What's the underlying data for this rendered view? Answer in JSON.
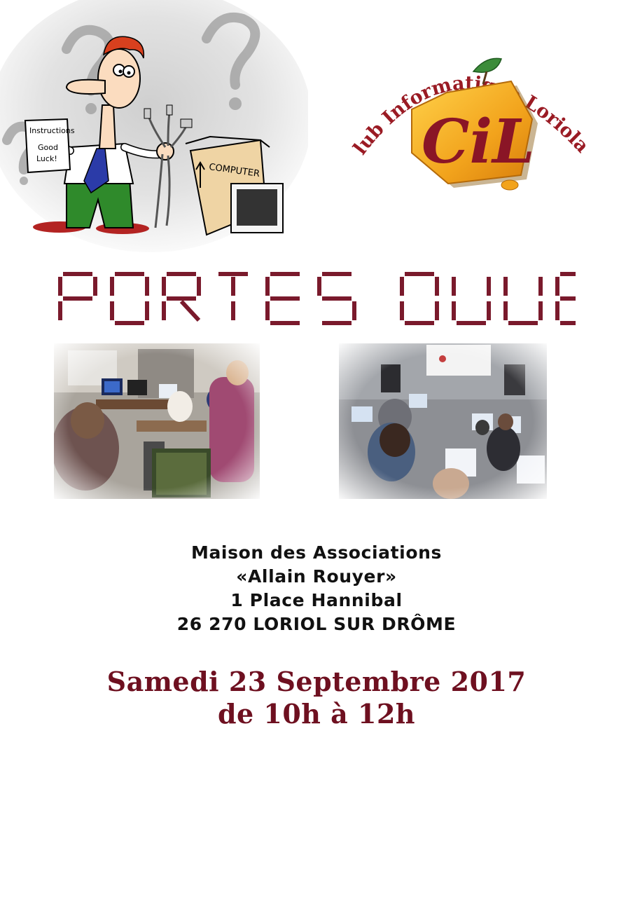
{
  "cartoon": {
    "paper_line1": "Instructions",
    "paper_line2": "Good",
    "paper_line3": "Luck!",
    "box_label": "COMPUTER"
  },
  "logo": {
    "arc_text": "Club Informatique Loriolais",
    "letters": "CiL"
  },
  "title": "PORTES OUVERTES",
  "address": {
    "line1": "Maison des Associations",
    "line2": "«Allain Rouyer»",
    "line3": "1 Place Hannibal",
    "line4": "26 270 LORIOL SUR DRÔME"
  },
  "event": {
    "date": "Samedi 23 Septembre 2017",
    "time": "de 10h à 12h"
  },
  "colors": {
    "title": "#7a1a2c",
    "date": "#6e1020",
    "logo_red": "#9a1b24",
    "logo_orange": "#f2a31c"
  }
}
